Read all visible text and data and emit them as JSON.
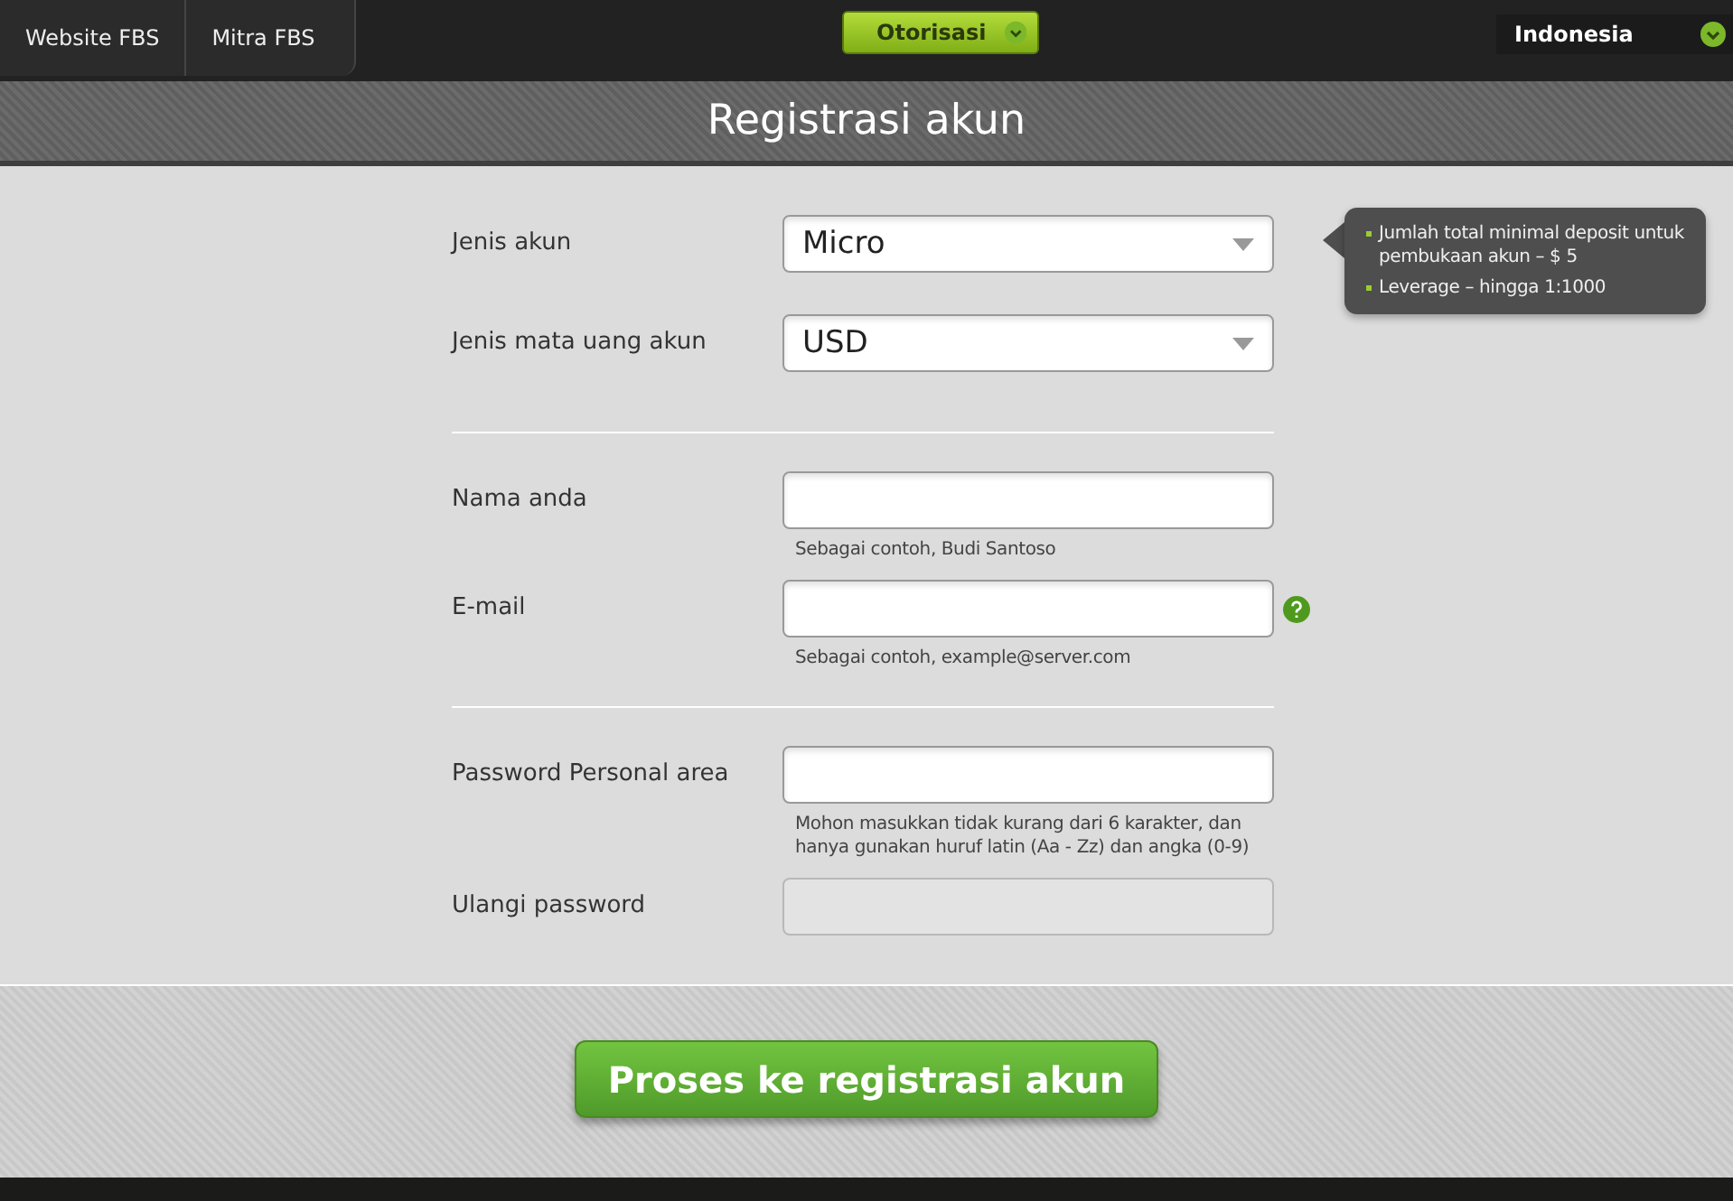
{
  "top_bar": {
    "links": [
      {
        "label": "Website FBS"
      },
      {
        "label": "Mitra FBS"
      }
    ],
    "login_button": "Otorisasi",
    "language": "Indonesia"
  },
  "title": "Registrasi akun",
  "groups": [
    {
      "fields": [
        {
          "kind": "select",
          "label": "Jenis akun",
          "value": "Micro",
          "disabled": false,
          "help": false
        },
        {
          "kind": "select",
          "label": "Jenis mata uang akun",
          "value": "USD",
          "disabled": false,
          "help": false
        }
      ]
    },
    {
      "fields": [
        {
          "kind": "text",
          "label": "Nama anda",
          "hint": "Sebagai contoh, Budi Santoso",
          "disabled": false,
          "help": false
        },
        {
          "kind": "text",
          "label": "E-mail",
          "hint": "Sebagai contoh, example@server.com",
          "disabled": false,
          "help": true
        }
      ]
    },
    {
      "fields": [
        {
          "kind": "text",
          "label": "Password Personal area",
          "hint": "Mohon masukkan tidak kurang dari 6 karakter, dan hanya gunakan huruf latin (Aa - Zz) dan angka (0-9)",
          "disabled": false,
          "help": false
        },
        {
          "kind": "text",
          "label": "Ulangi password",
          "disabled": true,
          "help": false
        }
      ]
    }
  ],
  "tooltip": {
    "items": [
      "Jumlah total minimal deposit untuk pembukaan akun – $ 5",
      "Leverage – hingga 1:1000"
    ]
  },
  "submit_button": "Proses ke registrasi akun"
}
